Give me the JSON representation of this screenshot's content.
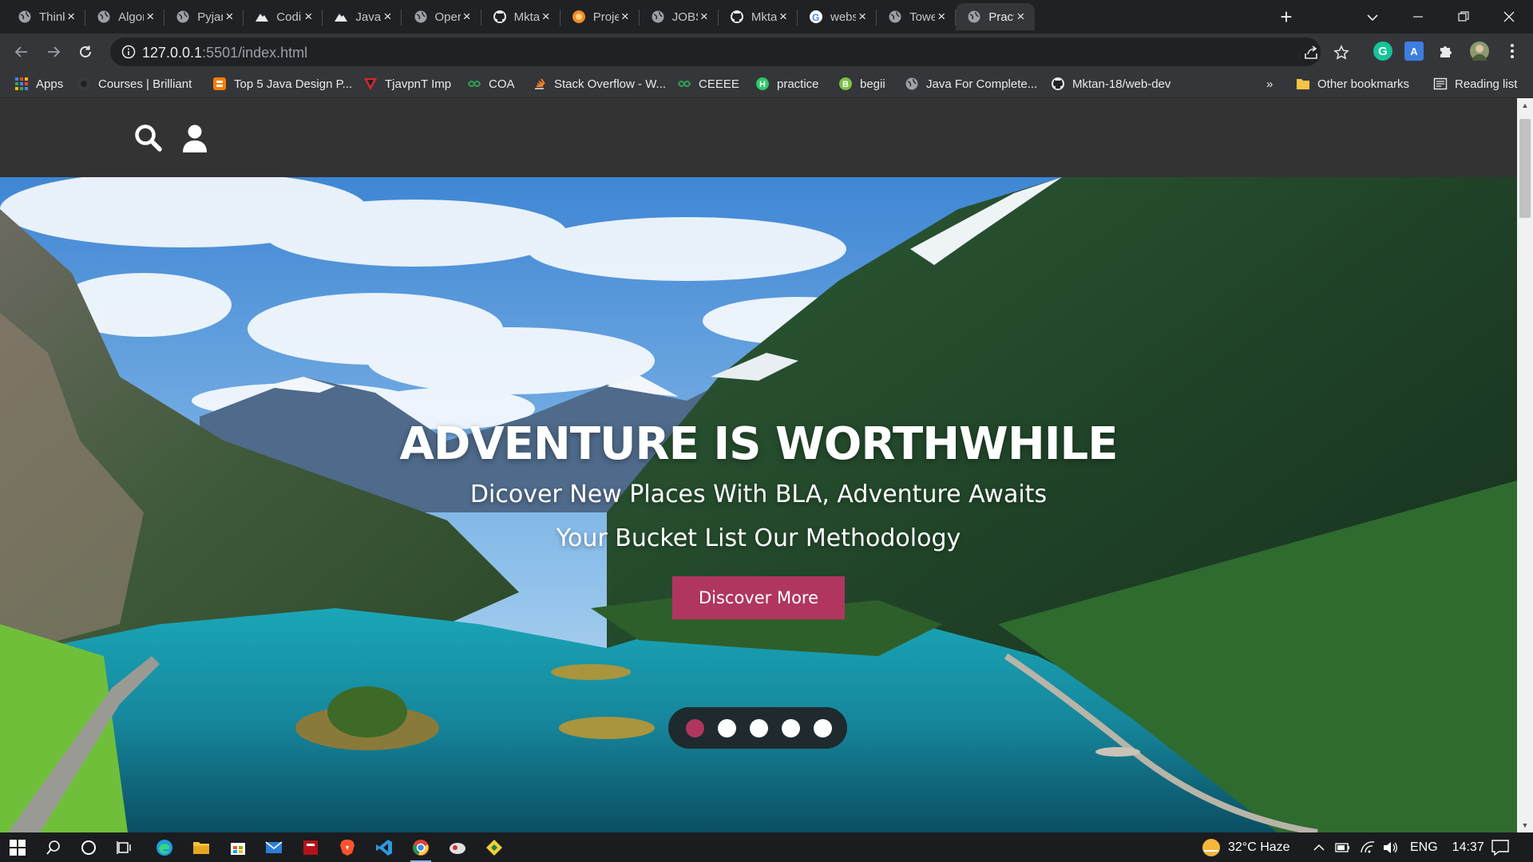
{
  "browser": {
    "tabs": [
      {
        "title": "Thinki",
        "icon": "globe-icon"
      },
      {
        "title": "Algori",
        "icon": "globe-icon"
      },
      {
        "title": "Pyjam",
        "icon": "globe-icon"
      },
      {
        "title": "Codin",
        "icon": "mountain-icon"
      },
      {
        "title": "Javasc",
        "icon": "mountain-icon"
      },
      {
        "title": "Opera",
        "icon": "globe-icon"
      },
      {
        "title": "Mktan",
        "icon": "github-icon"
      },
      {
        "title": "Projec",
        "icon": "orange-circle-icon"
      },
      {
        "title": "JOBSE",
        "icon": "globe-icon"
      },
      {
        "title": "Mktan",
        "icon": "github-icon"
      },
      {
        "title": "websi",
        "icon": "google-icon"
      },
      {
        "title": "Tower",
        "icon": "globe-icon"
      },
      {
        "title": "Practi",
        "icon": "globe-icon"
      }
    ],
    "active_tab_index": 12,
    "address": {
      "host": "127.0.0.1",
      "rest": ":5501/index.html"
    },
    "bookmarks": [
      {
        "label": "Apps",
        "icon": "apps-grid-icon"
      },
      {
        "label": "Courses | Brilliant",
        "icon": "brilliant-icon"
      },
      {
        "label": "Top 5 Java Design P...",
        "icon": "blogger-icon"
      },
      {
        "label": "TjavpnT Imp",
        "icon": "red-shield-icon"
      },
      {
        "label": "COA",
        "icon": "infinity-icon"
      },
      {
        "label": "Stack Overflow - W...",
        "icon": "stackoverflow-icon"
      },
      {
        "label": "CEEEE",
        "icon": "infinity-icon"
      },
      {
        "label": "practice",
        "icon": "hackerrank-icon"
      },
      {
        "label": "begii",
        "icon": "b-icon"
      },
      {
        "label": "Java For Complete...",
        "icon": "globe-icon"
      },
      {
        "label": "Mktan-18/web-dev",
        "icon": "github-icon"
      }
    ],
    "bookmarks_overflow": "»",
    "other_bookmarks": "Other bookmarks",
    "reading_list": "Reading list"
  },
  "page": {
    "hero": {
      "title": "ADVENTURE IS WORTHWHILE",
      "subtitle_1": "Dicover New Places With BLA, Adventure Awaits",
      "subtitle_2": "Your Bucket List Our Methodology",
      "cta": "Discover More"
    },
    "slides": {
      "count": 5,
      "active_index": 0
    }
  },
  "colors": {
    "accent": "#b03660",
    "nav_bg": "#333333",
    "chrome_bg": "#202124",
    "toolbar_bg": "#35363a"
  },
  "taskbar": {
    "apps": [
      "windows-start-icon",
      "search-icon",
      "cortana-icon",
      "task-view-icon",
      "edge-icon",
      "file-explorer-icon",
      "store-icon",
      "mail-icon",
      "app-red-icon",
      "brave-icon",
      "vscode-icon",
      "chrome-icon",
      "app-icon",
      "git-icon"
    ],
    "weather": "32°C  Haze",
    "language": "ENG",
    "time": "14:37"
  }
}
